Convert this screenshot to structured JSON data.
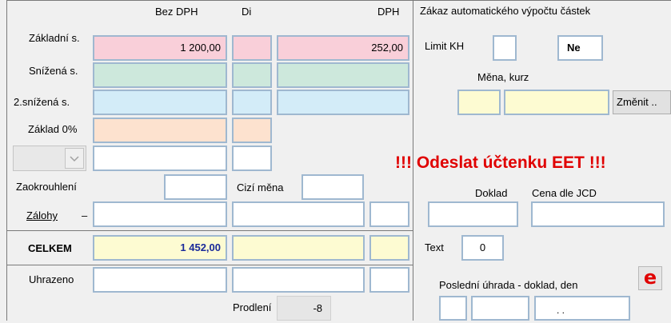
{
  "columns": {
    "bez_dph": "Bez DPH",
    "di": "Di",
    "dph": "DPH"
  },
  "rates": {
    "zakladni": {
      "label": "Základní s.",
      "bez_dph": "1 200,00",
      "dph": "252,00"
    },
    "snizena": {
      "label": "Snížená s."
    },
    "snizena2": {
      "label": "2.snížená s."
    },
    "zaklad0": {
      "label": "Základ 0%"
    }
  },
  "right": {
    "zakaz_label": "Zákaz automatického výpočtu částek",
    "limit_kh_label": "Limit KH",
    "limit_kh_value": "Ne",
    "mena_kurz_label": "Měna, kurz",
    "zmenit_button": "Změnit ..",
    "eet_warning": "!!! Odeslat účtenku EET !!!",
    "doklad_label": "Doklad",
    "cena_jcd_label": "Cena dle JCD",
    "text_label": "Text",
    "text_value": "0",
    "posledni_uhrada_label": "Poslední úhrada - doklad, den",
    "posledni_uhrada_value": ". .",
    "e_icon": "e"
  },
  "rows": {
    "zaokrouhleni_label": "Zaokrouhlení",
    "cizi_mena_label": "Cizí měna",
    "zalohy_label": "Zálohy",
    "zalohy_dash": "–",
    "celkem_label": "CELKEM",
    "celkem_value": "1 452,00",
    "uhrazeno_label": "Uhrazeno",
    "prodleni_label": "Prodlení",
    "prodleni_value": "-8"
  },
  "colors": {
    "accent_red": "#e00000",
    "celkem_value": "#1a2a9a"
  }
}
